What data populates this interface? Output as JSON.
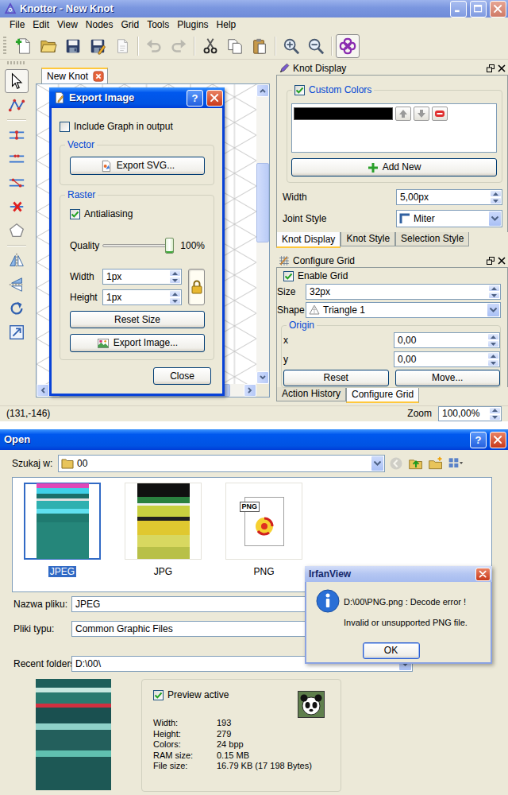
{
  "knotter": {
    "window": {
      "title": "Knotter - New Knot"
    },
    "menu": [
      "File",
      "Edit",
      "View",
      "Nodes",
      "Grid",
      "Tools",
      "Plugins",
      "Help"
    ],
    "toolbar": [
      [
        {
          "kind": "new",
          "disabled": false,
          "checked": false
        },
        {
          "kind": "open",
          "disabled": false,
          "checked": false
        },
        {
          "kind": "save",
          "disabled": false,
          "checked": false
        },
        {
          "kind": "save-as",
          "disabled": false,
          "checked": false
        },
        {
          "kind": "export",
          "disabled": false,
          "checked": false
        }
      ],
      [
        {
          "kind": "undo",
          "disabled": true,
          "checked": false
        },
        {
          "kind": "redo",
          "disabled": true,
          "checked": false
        }
      ],
      [
        {
          "kind": "cut",
          "disabled": false,
          "checked": false
        },
        {
          "kind": "copy",
          "disabled": false,
          "checked": false
        },
        {
          "kind": "paste",
          "disabled": false,
          "checked": false
        }
      ],
      [
        {
          "kind": "zoom-in",
          "disabled": false,
          "checked": false
        },
        {
          "kind": "zoom-out",
          "disabled": false,
          "checked": false
        }
      ],
      [
        {
          "kind": "knot-display",
          "disabled": false,
          "checked": true
        }
      ]
    ],
    "tools": [
      [
        {
          "kind": "select",
          "selected": true
        },
        {
          "kind": "edge-chain",
          "selected": false
        }
      ],
      [
        {
          "kind": "insert-edge",
          "selected": false
        },
        {
          "kind": "break-edge",
          "selected": false
        },
        {
          "kind": "chain-edge",
          "selected": false
        },
        {
          "kind": "erase",
          "selected": false
        },
        {
          "kind": "polygon",
          "selected": false
        }
      ],
      [
        {
          "kind": "mirror-h",
          "selected": false
        },
        {
          "kind": "mirror-v",
          "selected": false
        },
        {
          "kind": "rotate",
          "selected": false
        },
        {
          "kind": "scale",
          "selected": false
        }
      ]
    ],
    "document_tab": {
      "label": "New Knot",
      "selected": true
    },
    "canvas": {
      "vertical_scroll": {
        "offset": 0.24,
        "size": 0.29
      },
      "horizontal_scroll": {
        "offset": 0.05,
        "size": 0.88
      }
    },
    "export_dialog": {
      "title": "Export Image",
      "help": "?",
      "include_graph": {
        "label": "Include Graph in output",
        "checked": false
      },
      "vector": {
        "title": "Vector",
        "button": "Export SVG..."
      },
      "raster": {
        "title": "Raster",
        "antialiasing": {
          "label": "Antialiasing",
          "checked": true
        },
        "quality": {
          "label": "Quality",
          "level": 1,
          "reading": "100%"
        },
        "width": {
          "label": "Width",
          "value": "1px"
        },
        "height": {
          "label": "Height",
          "value": "1px"
        },
        "locked": true,
        "reset": "Reset Size",
        "export": "Export Image..."
      },
      "close": "Close"
    },
    "knot_display": {
      "title": "Knot Display",
      "custom_colors": {
        "label": "Custom Colors",
        "checked": true
      },
      "colors": [
        {
          "color": "#000000"
        }
      ],
      "add_new": "Add New",
      "width": {
        "label": "Width",
        "value": "5,00px"
      },
      "joint_style": {
        "label": "Joint Style",
        "value": "Miter"
      },
      "tabs": [
        {
          "label": "Knot Display",
          "selected": true
        },
        {
          "label": "Knot Style",
          "selected": false
        },
        {
          "label": "Selection Style",
          "selected": false
        }
      ]
    },
    "configure_grid": {
      "title": "Configure Grid",
      "enable_grid": {
        "label": "Enable Grid",
        "checked": true
      },
      "size": {
        "label": "Size",
        "value": "32px"
      },
      "shape": {
        "label": "Shape",
        "value": "Triangle 1"
      },
      "origin": {
        "title": "Origin",
        "x": {
          "label": "x",
          "value": "0,00"
        },
        "y": {
          "label": "y",
          "value": "0,00"
        }
      },
      "reset": "Reset",
      "move": "Move...",
      "tabs": [
        {
          "label": "Action History",
          "selected": false
        },
        {
          "label": "Configure Grid",
          "selected": true
        }
      ]
    },
    "status_bar": {
      "coords": "(131,-146)",
      "zoom_label": "Zoom",
      "zoom": "100,00%"
    }
  },
  "open_dialog": {
    "title": "Open",
    "help": "?",
    "look_in": {
      "label": "Szukaj w:",
      "value": "00"
    },
    "nav": [
      {
        "kind": "back",
        "disabled": true
      },
      {
        "kind": "up",
        "disabled": false
      },
      {
        "kind": "new-folder",
        "disabled": false
      },
      {
        "kind": "view",
        "disabled": false
      }
    ],
    "files": [
      {
        "name": "JPEG",
        "selected": true,
        "kind": "thumbnail"
      },
      {
        "name": "JPG",
        "selected": false,
        "kind": "thumbnail"
      },
      {
        "name": "PNG",
        "selected": false,
        "kind": "icon",
        "badge": "PNG"
      }
    ],
    "file_name": {
      "label": "Nazwa pliku:",
      "value": "JPEG"
    },
    "file_type": {
      "label": "Pliki typu:",
      "value": "Common Graphic Files"
    },
    "recent": {
      "label": "Recent folders:",
      "value": "D:\\00\\"
    },
    "preview": {
      "label": "Preview active",
      "checked": true
    },
    "image_info": [
      {
        "label": "Width:",
        "value": "193"
      },
      {
        "label": "Height:",
        "value": "279"
      },
      {
        "label": "Colors:",
        "value": "24 bpp"
      },
      {
        "label": "RAM size:",
        "value": "0.15 MB"
      },
      {
        "label": "File size:",
        "value": "16.79 KB (17 198 Bytes)"
      }
    ]
  },
  "error_dialog": {
    "title": "IrfanView",
    "message": "D:\\00\\PNG.png : Decode error !",
    "detail": "Invalid or unsupported PNG file.",
    "ok": "OK"
  }
}
